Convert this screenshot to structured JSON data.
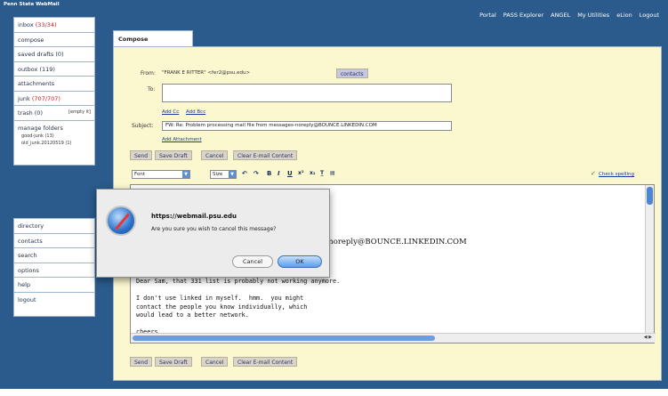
{
  "app": {
    "brand": "Penn State WebMail"
  },
  "topnav": [
    "Portal",
    "PASS Explorer",
    "ANGEL",
    "My Utilities",
    "eLion",
    "Logout"
  ],
  "sidebar": {
    "inbox_label": "inbox",
    "inbox_count": "(33/34)",
    "items": [
      "compose",
      "saved drafts (0)",
      "outbox (119)",
      "attachments"
    ],
    "junk_label": "junk",
    "junk_count": "(707/707)",
    "trash": "trash (0)",
    "empty_it": "[empty it]",
    "manage_folders": "manage folders",
    "folders": [
      "good-junk (13)",
      "old_junk.20120519 (1)"
    ],
    "bottom_items": [
      "directory",
      "contacts",
      "search",
      "options",
      "help",
      "logout"
    ]
  },
  "compose": {
    "tab": "Compose",
    "from_label": "From:",
    "from_value": "\"FRANK E RITTER\" <fer2@psu.edu>",
    "contacts_btn": "contacts",
    "to_label": "To:",
    "to_value": "",
    "add_cc": "Add Cc",
    "add_bcc": "Add Bcc",
    "subject_label": "Subject:",
    "subject_value": "FW: Re: Problem processing mail file from messages-noreply@BOUNCE.LINKEDIN.COM",
    "add_attachment": "Add Attachment",
    "buttons": {
      "send": "Send",
      "save_draft": "Save Draft",
      "cancel": "Cancel",
      "clear": "Clear E-mail Content"
    },
    "font_select": "Font",
    "size_select": "Size",
    "spell": "Check spelling",
    "editor_header": "s-noreply@BOUNCE.LINKEDIN.COM",
    "editor_body": "Dear Sam, that 331 list is probably not working anymore.\n\nI don't use linked in myself.  hmm.  you might\ncontact the people you know individually, which\nwould lead to a better network.\n\ncheers,"
  },
  "dialog": {
    "title": "https://webmail.psu.edu",
    "message": "Are you sure you wish to cancel this message?",
    "cancel": "Cancel",
    "ok": "OK"
  },
  "colors": {
    "frame": "#2a5b8c",
    "panel": "#fbf7cf",
    "junk_count": "#c81a1a"
  }
}
